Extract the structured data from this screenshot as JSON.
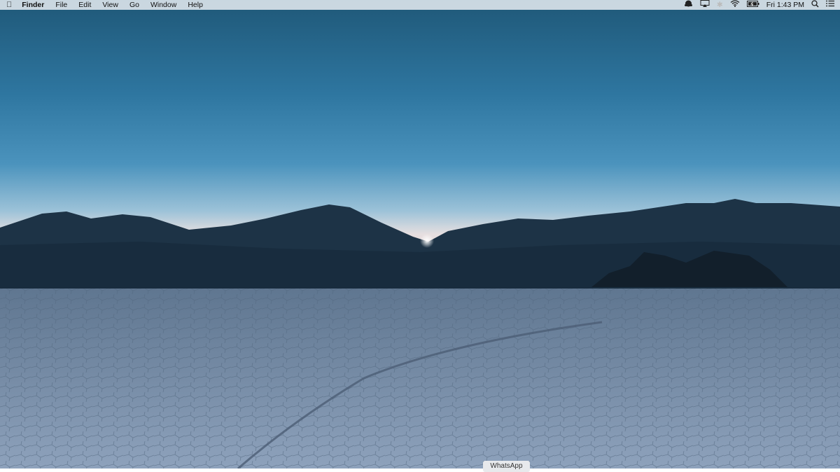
{
  "menubar": {
    "apple_icon": "apple-logo",
    "app_name": "Finder",
    "menus": [
      "File",
      "Edit",
      "View",
      "Go",
      "Window",
      "Help"
    ],
    "status": {
      "icons": [
        "cloud-icon",
        "airplay-icon",
        "bluetooth-icon",
        "wifi-icon",
        "battery-charging-icon"
      ],
      "clock": "Fri 1:43 PM",
      "spotlight_icon": "search-icon",
      "notification_icon": "list-icon"
    }
  },
  "dock_tooltip": "WhatsApp"
}
